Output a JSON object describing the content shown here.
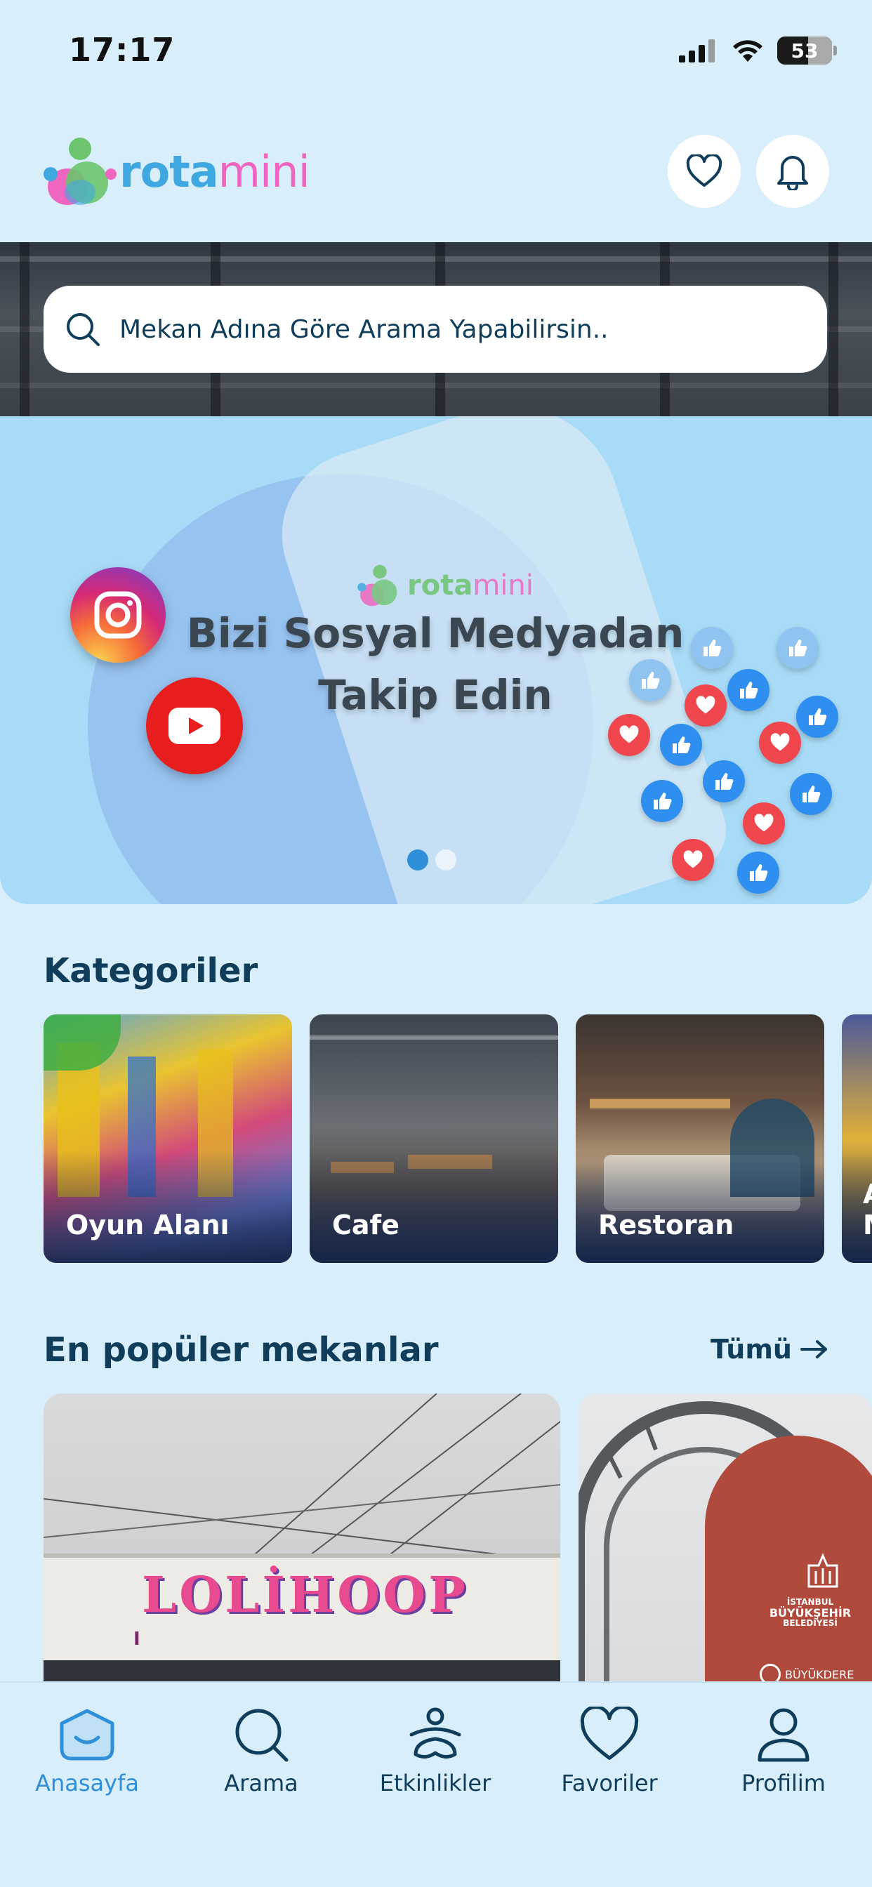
{
  "status_bar": {
    "time": "17:17",
    "battery": "53"
  },
  "header": {
    "logo_rota": "rota",
    "logo_mini": "mini",
    "favorites_icon": "heart-icon",
    "notifications_icon": "bell-icon"
  },
  "search": {
    "placeholder": "Mekan Adına Göre Arama Yapabilirsin.."
  },
  "banner": {
    "logo_rota": "rota",
    "logo_mini": "mini",
    "title_line1": "Bizi Sosyal Medyadan",
    "title_line2": "Takip Edin",
    "social_icons": [
      "instagram-icon",
      "youtube-icon"
    ],
    "page_count": 2,
    "active_page": 1
  },
  "categories": {
    "title": "Kategoriler",
    "items": [
      {
        "label": "Oyun Alanı"
      },
      {
        "label": "Cafe"
      },
      {
        "label": "Restoran"
      },
      {
        "label": "A\nM"
      }
    ]
  },
  "popular": {
    "title": "En popüler mekanlar",
    "see_all": "Tümü",
    "sign_text": "LOLİHOOP",
    "sign_letter": "I",
    "emblem_line1": "İSTANBUL",
    "emblem_line2": "BÜYÜKŞEHİR",
    "emblem_line3": "BELEDİYESİ",
    "emblem_bottom": "BÜYÜKDERE"
  },
  "tabbar": {
    "items": [
      {
        "label": "Anasayfa",
        "icon": "home-icon",
        "active": true
      },
      {
        "label": "Arama",
        "icon": "search-icon",
        "active": false
      },
      {
        "label": "Etkinlikler",
        "icon": "activity-icon",
        "active": false
      },
      {
        "label": "Favoriler",
        "icon": "heart-icon",
        "active": false
      },
      {
        "label": "Profilim",
        "icon": "profile-icon",
        "active": false
      }
    ]
  },
  "colors": {
    "background": "#d9eefb",
    "primary_text": "#0f3d5a",
    "accent_blue": "#3fa8e0",
    "accent_pink": "#f065c0",
    "active_tab": "#2f8fd8"
  }
}
